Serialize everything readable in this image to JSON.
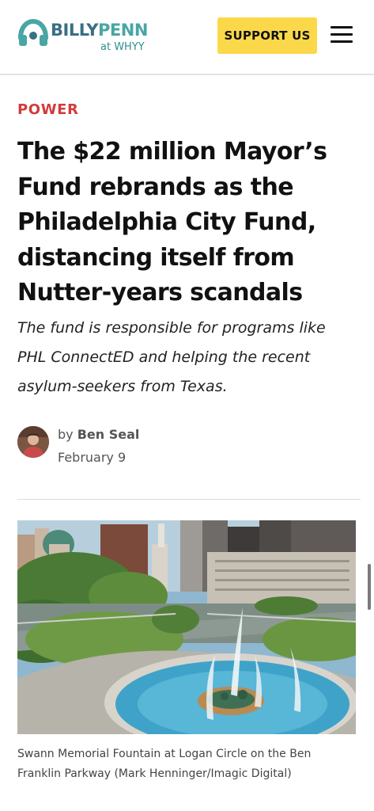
{
  "header": {
    "logo_main_left": "BILLY",
    "logo_main_right": "PENN",
    "logo_sub": "at WHYY",
    "support_label": "SUPPORT US",
    "menu_icon": "hamburger-menu-icon"
  },
  "article": {
    "kicker": "POWER",
    "headline": "The $22 million Mayor’s Fund rebrands as the Philadelphia City Fund, distancing itself from Nutter-years scandals",
    "dek": "The fund is responsible for programs like PHL ConnectED and helping the recent asylum-seekers from Texas.",
    "byline": {
      "prefix": "by",
      "author": "Ben Seal",
      "date": "February 9"
    },
    "image_caption": "Swann Memorial Fountain at Logan Circle on the Ben Franklin Parkway (Mark Henninger/Imagic Digital)"
  },
  "colors": {
    "accent_red": "#d23b3b",
    "support_yellow": "#fbd84a",
    "logo_blue": "#3a6f84",
    "logo_teal": "#48a6a4"
  }
}
